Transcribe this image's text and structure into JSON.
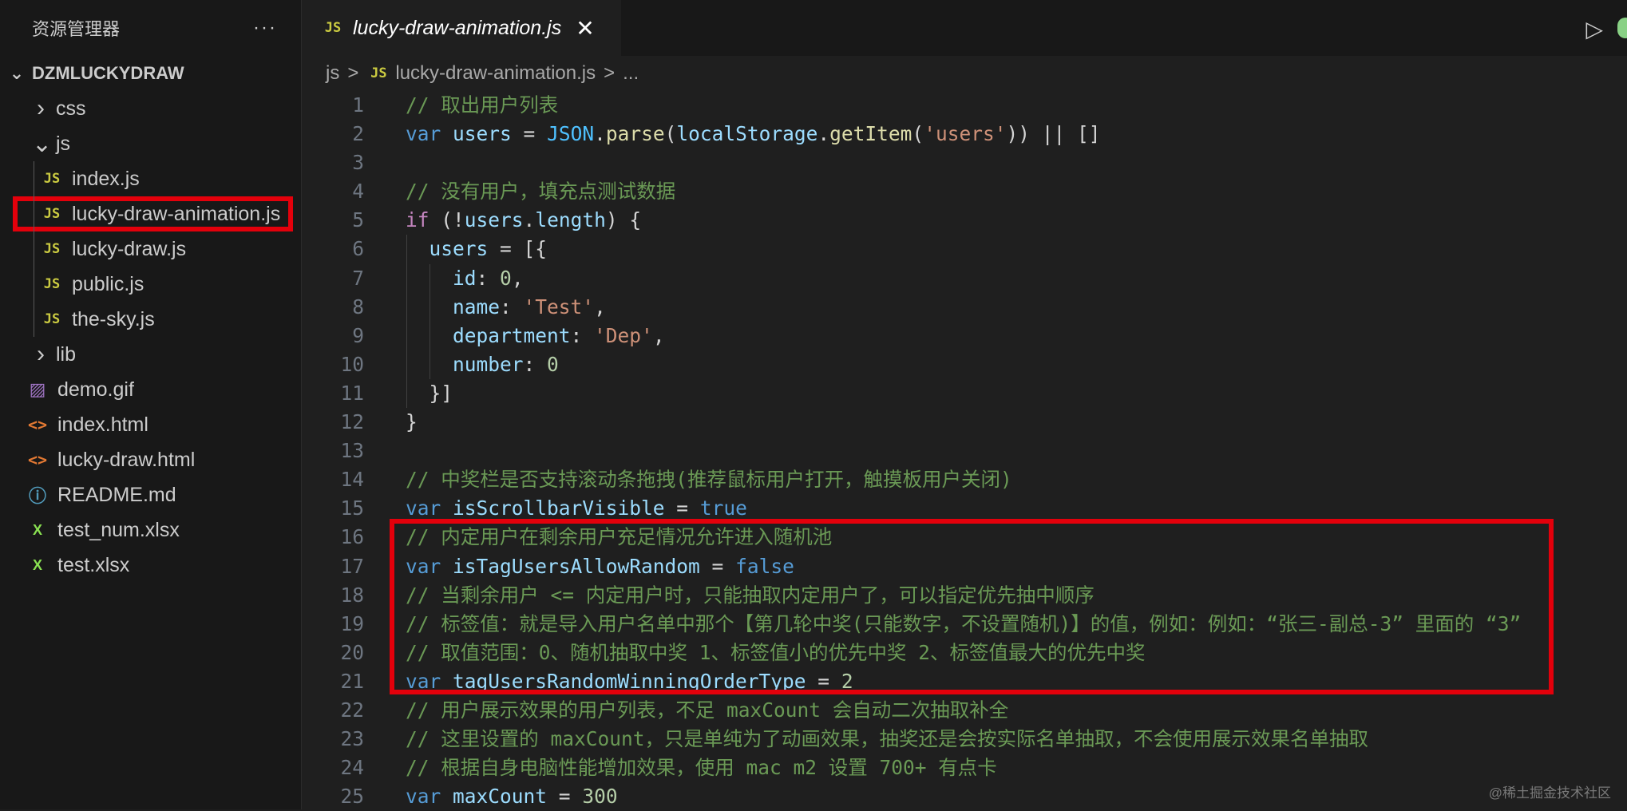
{
  "sidebar": {
    "title": "资源管理器",
    "more": "···",
    "folder": "DZMLUCKYDRAW",
    "items": [
      {
        "label": "css",
        "type": "folder",
        "collapsed": true,
        "depth": 0
      },
      {
        "label": "js",
        "type": "folder",
        "collapsed": false,
        "depth": 0
      },
      {
        "label": "index.js",
        "type": "js",
        "depth": 1
      },
      {
        "label": "lucky-draw-animation.js",
        "type": "js",
        "depth": 1,
        "selected": true
      },
      {
        "label": "lucky-draw.js",
        "type": "js",
        "depth": 1
      },
      {
        "label": "public.js",
        "type": "js",
        "depth": 1
      },
      {
        "label": "the-sky.js",
        "type": "js",
        "depth": 1
      },
      {
        "label": "lib",
        "type": "folder",
        "collapsed": true,
        "depth": 0
      },
      {
        "label": "demo.gif",
        "type": "gif",
        "depth": 0
      },
      {
        "label": "index.html",
        "type": "html",
        "depth": 0
      },
      {
        "label": "lucky-draw.html",
        "type": "html",
        "depth": 0
      },
      {
        "label": "README.md",
        "type": "md",
        "depth": 0
      },
      {
        "label": "test_num.xlsx",
        "type": "xlsx",
        "depth": 0
      },
      {
        "label": "test.xlsx",
        "type": "xlsx",
        "depth": 0
      }
    ],
    "icons": {
      "js": "JS",
      "gif": "▨",
      "html": "<>",
      "md": "ⓘ",
      "xlsx": "X"
    }
  },
  "editor": {
    "tab": {
      "icon": "JS",
      "label": "lucky-draw-animation.js",
      "close": "✕"
    },
    "run_icon": "▷",
    "breadcrumb": {
      "folder": "js",
      "sep": ">",
      "icon": "JS",
      "file": "lucky-draw-animation.js",
      "more": "..."
    },
    "lines": [
      {
        "n": "1",
        "tokens": [
          [
            "comment",
            "// 取出用户列表"
          ]
        ]
      },
      {
        "n": "2",
        "tokens": [
          [
            "kw",
            "var"
          ],
          [
            "punct",
            " "
          ],
          [
            "var",
            "users"
          ],
          [
            "punct",
            " = "
          ],
          [
            "const",
            "JSON"
          ],
          [
            "punct",
            "."
          ],
          [
            "fn",
            "parse"
          ],
          [
            "punct",
            "("
          ],
          [
            "var",
            "localStorage"
          ],
          [
            "punct",
            "."
          ],
          [
            "fn",
            "getItem"
          ],
          [
            "punct",
            "("
          ],
          [
            "str",
            "'users'"
          ],
          [
            "punct",
            ")) || []"
          ]
        ]
      },
      {
        "n": "3",
        "tokens": []
      },
      {
        "n": "4",
        "tokens": [
          [
            "comment",
            "// 没有用户，填充点测试数据"
          ]
        ]
      },
      {
        "n": "5",
        "tokens": [
          [
            "ctrl",
            "if"
          ],
          [
            "punct",
            " (!"
          ],
          [
            "var",
            "users"
          ],
          [
            "punct",
            "."
          ],
          [
            "var",
            "length"
          ],
          [
            "punct",
            ") {"
          ]
        ]
      },
      {
        "n": "6",
        "tokens": [
          [
            "punct",
            "  "
          ],
          [
            "var",
            "users"
          ],
          [
            "punct",
            " = [{"
          ]
        ]
      },
      {
        "n": "7",
        "tokens": [
          [
            "punct",
            "    "
          ],
          [
            "var",
            "id"
          ],
          [
            "punct",
            ": "
          ],
          [
            "num",
            "0"
          ],
          [
            "punct",
            ","
          ]
        ]
      },
      {
        "n": "8",
        "tokens": [
          [
            "punct",
            "    "
          ],
          [
            "var",
            "name"
          ],
          [
            "punct",
            ": "
          ],
          [
            "str",
            "'Test'"
          ],
          [
            "punct",
            ","
          ]
        ]
      },
      {
        "n": "9",
        "tokens": [
          [
            "punct",
            "    "
          ],
          [
            "var",
            "department"
          ],
          [
            "punct",
            ": "
          ],
          [
            "str",
            "'Dep'"
          ],
          [
            "punct",
            ","
          ]
        ]
      },
      {
        "n": "10",
        "tokens": [
          [
            "punct",
            "    "
          ],
          [
            "var",
            "number"
          ],
          [
            "punct",
            ": "
          ],
          [
            "num",
            "0"
          ]
        ]
      },
      {
        "n": "11",
        "tokens": [
          [
            "punct",
            "  }]"
          ]
        ]
      },
      {
        "n": "12",
        "tokens": [
          [
            "punct",
            "}"
          ]
        ]
      },
      {
        "n": "13",
        "tokens": []
      },
      {
        "n": "14",
        "tokens": [
          [
            "comment",
            "// 中奖栏是否支持滚动条拖拽(推荐鼠标用户打开，触摸板用户关闭)"
          ]
        ]
      },
      {
        "n": "15",
        "tokens": [
          [
            "kw",
            "var"
          ],
          [
            "punct",
            " "
          ],
          [
            "var",
            "isScrollbarVisible"
          ],
          [
            "punct",
            " = "
          ],
          [
            "bool",
            "true"
          ]
        ]
      },
      {
        "n": "16",
        "tokens": [
          [
            "comment",
            "// 内定用户在剩余用户充足情况允许进入随机池"
          ]
        ]
      },
      {
        "n": "17",
        "tokens": [
          [
            "kw",
            "var"
          ],
          [
            "punct",
            " "
          ],
          [
            "var",
            "isTagUsersAllowRandom"
          ],
          [
            "punct",
            " = "
          ],
          [
            "bool",
            "false"
          ]
        ]
      },
      {
        "n": "18",
        "tokens": [
          [
            "comment",
            "// 当剩余用户 <= 内定用户时，只能抽取内定用户了，可以指定优先抽中顺序"
          ]
        ]
      },
      {
        "n": "19",
        "tokens": [
          [
            "comment",
            "// 标签值：就是导入用户名单中那个【第几轮中奖(只能数字，不设置随机)】的值，例如：例如：“张三-副总-3” 里面的 “3”"
          ]
        ]
      },
      {
        "n": "20",
        "tokens": [
          [
            "comment",
            "// 取值范围：0、随机抽取中奖 1、标签值小的优先中奖 2、标签值最大的优先中奖"
          ]
        ]
      },
      {
        "n": "21",
        "tokens": [
          [
            "kw",
            "var"
          ],
          [
            "punct",
            " "
          ],
          [
            "var",
            "tagUsersRandomWinningOrderType"
          ],
          [
            "punct",
            " = "
          ],
          [
            "num",
            "2"
          ]
        ]
      },
      {
        "n": "22",
        "tokens": [
          [
            "comment",
            "// 用户展示效果的用户列表，不足 maxCount 会自动二次抽取补全"
          ]
        ]
      },
      {
        "n": "23",
        "tokens": [
          [
            "comment",
            "// 这里设置的 maxCount，只是单纯为了动画效果，抽奖还是会按实际名单抽取，不会使用展示效果名单抽取"
          ]
        ]
      },
      {
        "n": "24",
        "tokens": [
          [
            "comment",
            "// 根据自身电脑性能增加效果，使用 mac m2 设置 700+ 有点卡"
          ]
        ]
      },
      {
        "n": "25",
        "tokens": [
          [
            "kw",
            "var"
          ],
          [
            "punct",
            " "
          ],
          [
            "var",
            "maxCount"
          ],
          [
            "punct",
            " = "
          ],
          [
            "num",
            "300"
          ]
        ]
      }
    ]
  },
  "watermark": "@稀土掘金技术社区",
  "colors": {
    "highlight": "#e3000b",
    "background": "#1f1f1f",
    "sidebar": "#181818"
  }
}
